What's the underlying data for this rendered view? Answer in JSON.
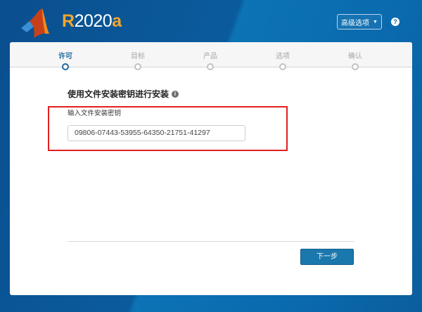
{
  "header": {
    "version_prefix": "R",
    "version_year": "2020",
    "version_suffix": "a",
    "advanced_options": "高级选项",
    "help": "?"
  },
  "steps": [
    {
      "label": "许可",
      "active": true
    },
    {
      "label": "目标",
      "active": false
    },
    {
      "label": "产品",
      "active": false
    },
    {
      "label": "选项",
      "active": false
    },
    {
      "label": "确认",
      "active": false
    }
  ],
  "main": {
    "title": "使用文件安装密钥进行安装",
    "info": "i",
    "field_label": "输入文件安装密钥",
    "key_value": "09806-07443-53955-64350-21751-41297",
    "next_button": "下一步"
  },
  "colors": {
    "accent": "#1a78ad",
    "highlight": "#e02020"
  }
}
